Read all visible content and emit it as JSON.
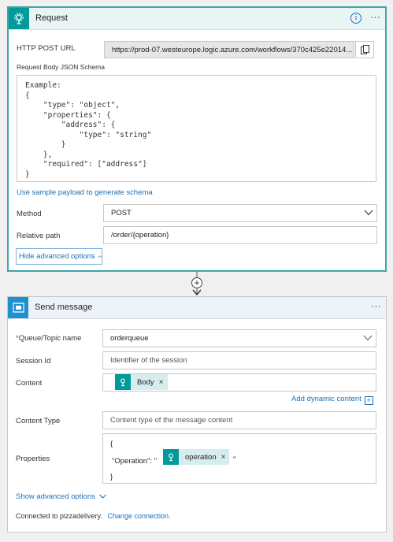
{
  "request": {
    "title": "Request",
    "http_post_url_label": "HTTP POST URL",
    "http_post_url_value": "https://prod-07.westeurope.logic.azure.com/workflows/370c425e22014...",
    "schema_label": "Request Body JSON Schema",
    "schema_text": "Example:\n{\n    \"type\": \"object\",\n    \"properties\": {\n        \"address\": {\n            \"type\": \"string\"\n        }\n    },\n    \"required\": [\"address\"]\n}",
    "sample_payload_link": "Use sample payload to generate schema",
    "method_label": "Method",
    "method_value": "POST",
    "relative_path_label": "Relative path",
    "relative_path_value": "/order/{operation}",
    "hide_advanced_label": "Hide advanced options"
  },
  "send": {
    "title": "Send message",
    "queue_label": "Queue/Topic name",
    "queue_value": "orderqueue",
    "session_label": "Session Id",
    "session_placeholder": "Identifier of the session",
    "content_label": "Content",
    "content_token": "Body",
    "add_dynamic_label": "Add dynamic content",
    "content_type_label": "Content Type",
    "content_type_placeholder": "Content type of the message content",
    "properties_label": "Properties",
    "properties_open": "{",
    "properties_key": "\"Operation\": \"",
    "properties_token": "operation",
    "properties_quote_close": "\"",
    "properties_close": "}",
    "show_advanced_label": "Show advanced options",
    "connected_text": "Connected to pizzadelivery.",
    "change_connection_link": "Change connection."
  },
  "colors": {
    "request_accent": "#009a9a",
    "servicebus_accent": "#1f8fd0",
    "link": "#1a6fb7"
  },
  "icons": {
    "request": "request-trigger-icon",
    "servicebus": "service-bus-icon",
    "info": "info-icon",
    "more": "more-options-icon",
    "copy": "copy-icon",
    "chevron": "chevron-down-icon",
    "add": "add-step-icon"
  }
}
